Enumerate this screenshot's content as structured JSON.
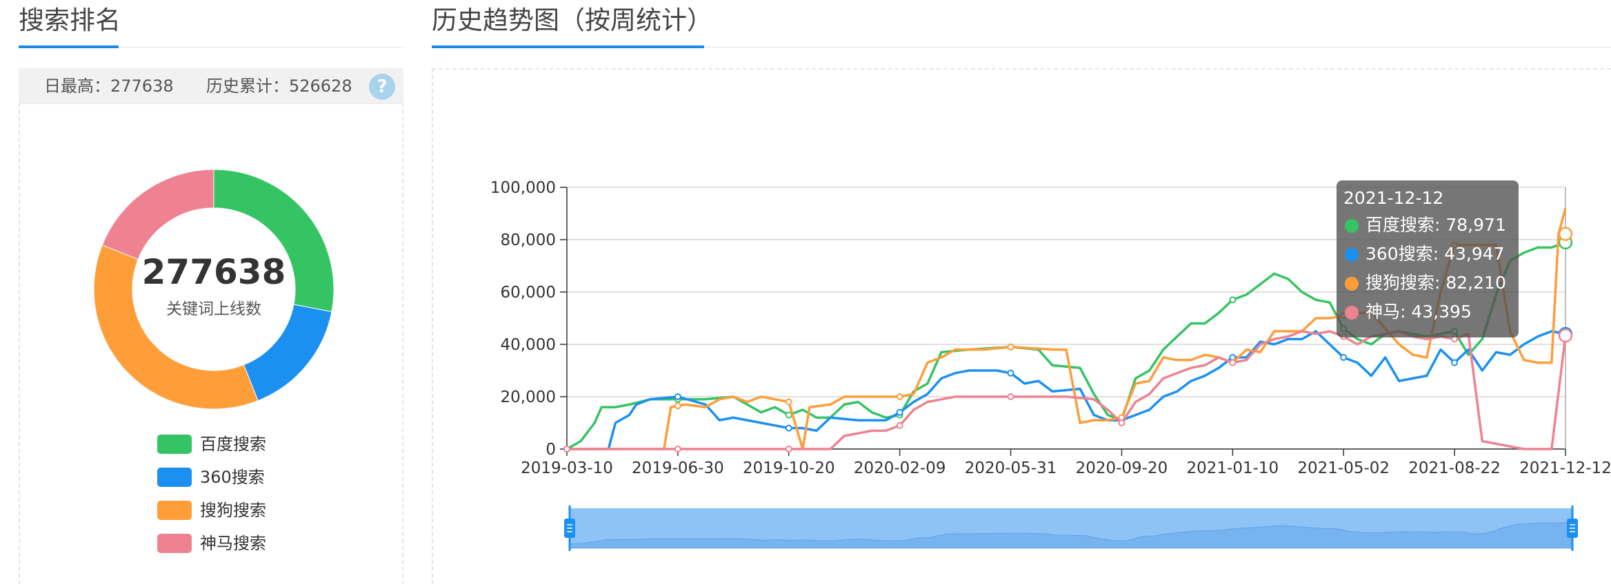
{
  "left": {
    "title": "搜索排名",
    "stats": {
      "daily_max_label": "日最高：",
      "daily_max_value": "277638",
      "total_label": "历史累计：",
      "total_value": "526628"
    },
    "help_icon_text": "?",
    "donut": {
      "center_value": "277638",
      "center_label": "关键词上线数",
      "slices": [
        {
          "name": "百度搜索",
          "value": 28,
          "color": "#34c463"
        },
        {
          "name": "360搜索",
          "value": 16,
          "color": "#1b90f0"
        },
        {
          "name": "搜狗搜索",
          "value": 37,
          "color": "#ff9d38"
        },
        {
          "name": "神马搜索",
          "value": 19,
          "color": "#ee8291"
        }
      ]
    }
  },
  "right": {
    "title": "历史趋势图（按周统计）"
  },
  "tooltip": {
    "date": "2021-12-12",
    "rows": [
      {
        "label": "百度搜索: 78,971",
        "color": "#34c463"
      },
      {
        "label": "360搜索: 43,947",
        "color": "#1b90f0"
      },
      {
        "label": "搜狗搜索: 82,210",
        "color": "#ff9d38"
      },
      {
        "label": "神马: 43,395",
        "color": "#ee8291"
      }
    ]
  },
  "chart_data": {
    "type": "line",
    "ylim": [
      0,
      100000
    ],
    "y_ticks": [
      "0",
      "20,000",
      "40,000",
      "60,000",
      "80,000",
      "100,000"
    ],
    "x_tick_labels": [
      "2019-03-10",
      "2019-06-30",
      "2019-10-20",
      "2020-02-09",
      "2020-05-31",
      "2020-09-20",
      "2021-01-10",
      "2021-05-02",
      "2021-08-22",
      "2021-12-12"
    ],
    "x_tick_weeks": [
      0,
      16,
      32,
      48,
      64,
      80,
      96,
      112,
      128,
      144
    ],
    "grid": true,
    "series": [
      {
        "name": "百度搜索",
        "color": "#34c463",
        "points": [
          [
            0,
            0
          ],
          [
            2,
            3000
          ],
          [
            4,
            10000
          ],
          [
            5,
            16000
          ],
          [
            7,
            16000
          ],
          [
            9,
            17000
          ],
          [
            12,
            19000
          ],
          [
            16,
            19000
          ],
          [
            20,
            19000
          ],
          [
            24,
            20000
          ],
          [
            26,
            17000
          ],
          [
            28,
            14000
          ],
          [
            30,
            16000
          ],
          [
            32,
            13000
          ],
          [
            34,
            15000
          ],
          [
            36,
            12000
          ],
          [
            38,
            12000
          ],
          [
            40,
            17000
          ],
          [
            42,
            18000
          ],
          [
            44,
            14000
          ],
          [
            46,
            12000
          ],
          [
            48,
            13000
          ],
          [
            50,
            22000
          ],
          [
            52,
            25000
          ],
          [
            54,
            37000
          ],
          [
            58,
            38000
          ],
          [
            64,
            39000
          ],
          [
            68,
            38000
          ],
          [
            70,
            32000
          ],
          [
            74,
            31000
          ],
          [
            76,
            21000
          ],
          [
            78,
            13000
          ],
          [
            80,
            11000
          ],
          [
            82,
            27000
          ],
          [
            84,
            30000
          ],
          [
            86,
            38000
          ],
          [
            88,
            43000
          ],
          [
            90,
            48000
          ],
          [
            92,
            48000
          ],
          [
            94,
            52000
          ],
          [
            96,
            57000
          ],
          [
            98,
            59000
          ],
          [
            100,
            63000
          ],
          [
            102,
            67000
          ],
          [
            104,
            65000
          ],
          [
            106,
            60000
          ],
          [
            108,
            57000
          ],
          [
            110,
            56000
          ],
          [
            112,
            46000
          ],
          [
            114,
            42000
          ],
          [
            116,
            40000
          ],
          [
            118,
            44000
          ],
          [
            120,
            45000
          ],
          [
            122,
            44000
          ],
          [
            124,
            43000
          ],
          [
            126,
            44000
          ],
          [
            128,
            45000
          ],
          [
            130,
            36000
          ],
          [
            132,
            42000
          ],
          [
            134,
            59000
          ],
          [
            136,
            72000
          ],
          [
            138,
            75000
          ],
          [
            140,
            77000
          ],
          [
            142,
            77000
          ],
          [
            144,
            78971
          ]
        ]
      },
      {
        "name": "360搜索",
        "color": "#1b90f0",
        "points": [
          [
            0,
            0
          ],
          [
            6,
            0
          ],
          [
            7,
            10000
          ],
          [
            9,
            13000
          ],
          [
            10,
            17000
          ],
          [
            12,
            19000
          ],
          [
            16,
            20000
          ],
          [
            20,
            17000
          ],
          [
            22,
            11000
          ],
          [
            24,
            12000
          ],
          [
            28,
            10000
          ],
          [
            30,
            9000
          ],
          [
            32,
            8000
          ],
          [
            34,
            8000
          ],
          [
            36,
            7000
          ],
          [
            38,
            12000
          ],
          [
            42,
            11000
          ],
          [
            46,
            11000
          ],
          [
            48,
            14000
          ],
          [
            50,
            18000
          ],
          [
            52,
            21000
          ],
          [
            54,
            27000
          ],
          [
            56,
            29000
          ],
          [
            58,
            30000
          ],
          [
            62,
            30000
          ],
          [
            64,
            29000
          ],
          [
            66,
            25000
          ],
          [
            68,
            26000
          ],
          [
            70,
            22000
          ],
          [
            74,
            23000
          ],
          [
            76,
            13000
          ],
          [
            78,
            11000
          ],
          [
            80,
            11000
          ],
          [
            82,
            13000
          ],
          [
            84,
            15000
          ],
          [
            86,
            20000
          ],
          [
            88,
            22000
          ],
          [
            90,
            26000
          ],
          [
            92,
            28000
          ],
          [
            94,
            31000
          ],
          [
            96,
            35000
          ],
          [
            98,
            35000
          ],
          [
            100,
            41000
          ],
          [
            102,
            40000
          ],
          [
            104,
            42000
          ],
          [
            106,
            42000
          ],
          [
            108,
            45000
          ],
          [
            110,
            40000
          ],
          [
            112,
            35000
          ],
          [
            114,
            33000
          ],
          [
            116,
            28000
          ],
          [
            118,
            35000
          ],
          [
            120,
            26000
          ],
          [
            122,
            27000
          ],
          [
            124,
            28000
          ],
          [
            126,
            38000
          ],
          [
            128,
            33000
          ],
          [
            130,
            38000
          ],
          [
            132,
            30000
          ],
          [
            134,
            37000
          ],
          [
            136,
            36000
          ],
          [
            138,
            40000
          ],
          [
            140,
            43000
          ],
          [
            142,
            45000
          ],
          [
            144,
            43947
          ]
        ]
      },
      {
        "name": "搜狗搜索",
        "color": "#ff9d38",
        "points": [
          [
            0,
            0
          ],
          [
            14,
            0
          ],
          [
            15,
            16000
          ],
          [
            17,
            17000
          ],
          [
            20,
            16000
          ],
          [
            22,
            19000
          ],
          [
            24,
            20000
          ],
          [
            26,
            18000
          ],
          [
            28,
            20000
          ],
          [
            30,
            19000
          ],
          [
            32,
            18000
          ],
          [
            34,
            0
          ],
          [
            35,
            16000
          ],
          [
            38,
            17000
          ],
          [
            40,
            20000
          ],
          [
            44,
            20000
          ],
          [
            46,
            20000
          ],
          [
            48,
            20000
          ],
          [
            50,
            21000
          ],
          [
            52,
            33000
          ],
          [
            54,
            35000
          ],
          [
            56,
            38000
          ],
          [
            60,
            38000
          ],
          [
            64,
            39000
          ],
          [
            70,
            38000
          ],
          [
            72,
            38000
          ],
          [
            74,
            10000
          ],
          [
            76,
            11000
          ],
          [
            78,
            11000
          ],
          [
            80,
            12000
          ],
          [
            82,
            25000
          ],
          [
            84,
            26000
          ],
          [
            86,
            35000
          ],
          [
            88,
            34000
          ],
          [
            90,
            34000
          ],
          [
            92,
            36000
          ],
          [
            94,
            35000
          ],
          [
            96,
            33000
          ],
          [
            98,
            38000
          ],
          [
            100,
            37000
          ],
          [
            102,
            45000
          ],
          [
            104,
            45000
          ],
          [
            106,
            45000
          ],
          [
            108,
            50000
          ],
          [
            110,
            50000
          ],
          [
            112,
            51000
          ],
          [
            114,
            52000
          ],
          [
            116,
            52000
          ],
          [
            118,
            46000
          ],
          [
            120,
            40000
          ],
          [
            122,
            36000
          ],
          [
            124,
            35000
          ],
          [
            126,
            60000
          ],
          [
            128,
            78000
          ],
          [
            130,
            78000
          ],
          [
            132,
            78000
          ],
          [
            134,
            78000
          ],
          [
            136,
            45000
          ],
          [
            138,
            34000
          ],
          [
            140,
            33000
          ],
          [
            142,
            33000
          ],
          [
            143,
            82210
          ],
          [
            144,
            92000
          ]
        ]
      },
      {
        "name": "神马",
        "color": "#ee8291",
        "points": [
          [
            0,
            0
          ],
          [
            38,
            0
          ],
          [
            40,
            5000
          ],
          [
            44,
            7000
          ],
          [
            46,
            7000
          ],
          [
            48,
            9000
          ],
          [
            50,
            15000
          ],
          [
            52,
            18000
          ],
          [
            54,
            19000
          ],
          [
            56,
            20000
          ],
          [
            60,
            20000
          ],
          [
            64,
            20000
          ],
          [
            68,
            20000
          ],
          [
            72,
            20000
          ],
          [
            76,
            19000
          ],
          [
            78,
            15000
          ],
          [
            80,
            10000
          ],
          [
            82,
            18000
          ],
          [
            84,
            21000
          ],
          [
            86,
            27000
          ],
          [
            88,
            29000
          ],
          [
            90,
            31000
          ],
          [
            92,
            32000
          ],
          [
            94,
            35000
          ],
          [
            96,
            33000
          ],
          [
            98,
            34000
          ],
          [
            100,
            40000
          ],
          [
            102,
            42000
          ],
          [
            104,
            43000
          ],
          [
            106,
            45000
          ],
          [
            108,
            44000
          ],
          [
            110,
            45000
          ],
          [
            112,
            43000
          ],
          [
            114,
            40000
          ],
          [
            116,
            43000
          ],
          [
            118,
            44000
          ],
          [
            120,
            45000
          ],
          [
            122,
            43000
          ],
          [
            124,
            42000
          ],
          [
            126,
            43000
          ],
          [
            128,
            42000
          ],
          [
            130,
            44000
          ],
          [
            132,
            3000
          ],
          [
            134,
            2000
          ],
          [
            136,
            1000
          ],
          [
            138,
            0
          ],
          [
            142,
            0
          ],
          [
            144,
            43395
          ]
        ]
      }
    ]
  }
}
